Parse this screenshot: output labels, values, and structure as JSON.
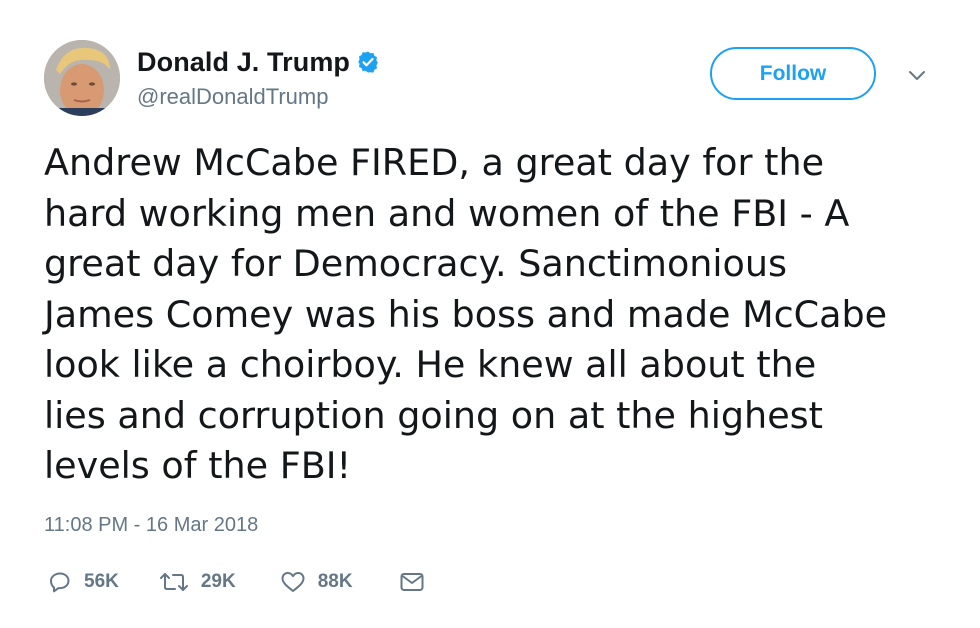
{
  "author": {
    "display_name": "Donald J. Trump",
    "handle": "@realDonaldTrump",
    "verified": true
  },
  "follow_button": {
    "label": "Follow"
  },
  "tweet": {
    "text": "Andrew McCabe FIRED, a great day for the\nhard working men and women of the FBI - A\ngreat day for Democracy. Sanctimonious\nJames Comey was his boss and made McCabe\nlook like a choirboy. He knew all about the\nlies and corruption going on at the highest\nlevels of the FBI!",
    "timestamp": "11:08 PM - 16 Mar 2018"
  },
  "stats": {
    "replies": "56K",
    "retweets": "29K",
    "likes": "88K"
  },
  "icons": {
    "verified": "verified-badge-icon",
    "menu": "chevron-down-icon",
    "reply": "reply-icon",
    "retweet": "retweet-icon",
    "like": "heart-icon",
    "message": "envelope-icon"
  },
  "colors": {
    "accent": "#1da1f2",
    "text": "#14171a",
    "secondary": "#657786"
  }
}
